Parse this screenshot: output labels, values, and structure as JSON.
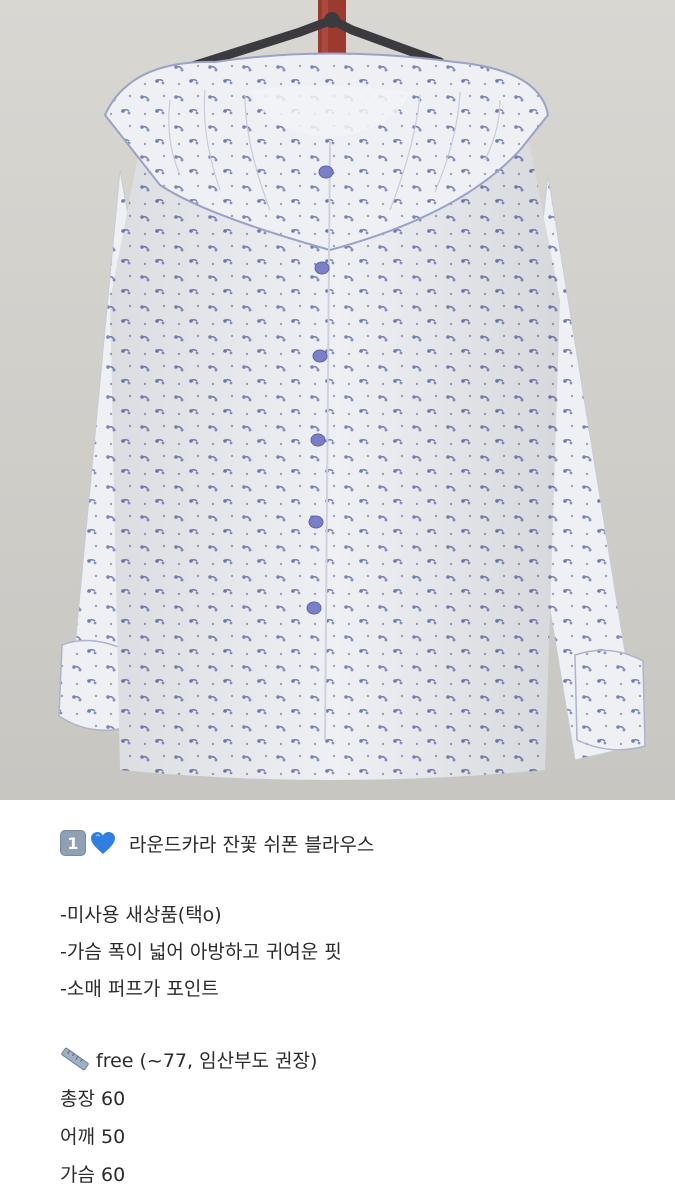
{
  "photo": {
    "subject": "floral blouse on hanger",
    "colors": {
      "wall": "#d4d2cd",
      "blouse": "#eef0f4",
      "pattern": "#7b86b5",
      "button": "#7a7fc8",
      "hanger": "#3b3b3f",
      "pole": "#9b3a2e"
    }
  },
  "caption": {
    "number_badge": "1",
    "heart_icon": "blue-heart-icon",
    "title": "라운드카라 잔꽃 쉬폰 블라우스",
    "features": [
      "-미사용 새상품(택o)",
      "-가슴 폭이 넓어 아방하고 귀여운 핏",
      "-소매 퍼프가 포인트"
    ],
    "size_line": "free (~77, 임산부도 권장)",
    "measurements": [
      "총장 60",
      "어깨 50",
      "가슴 60"
    ]
  }
}
